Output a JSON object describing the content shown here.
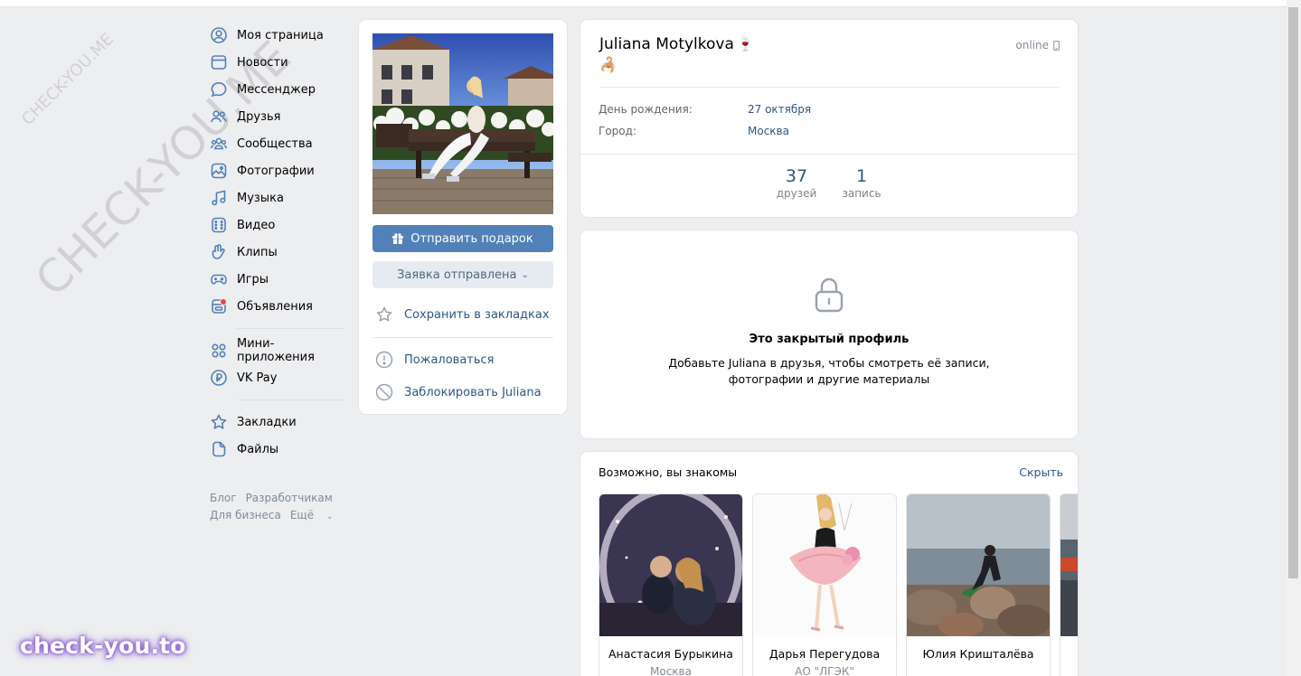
{
  "watermark": {
    "small": "CHECK-YOU.ME",
    "large": "CHECK-YOU.ME"
  },
  "brand": "check-you.to",
  "nav": {
    "items": [
      {
        "label": "Моя страница",
        "icon": "user-circle-icon"
      },
      {
        "label": "Новости",
        "icon": "news-icon"
      },
      {
        "label": "Мессенджер",
        "icon": "message-icon"
      },
      {
        "label": "Друзья",
        "icon": "friends-icon"
      },
      {
        "label": "Сообщества",
        "icon": "communities-icon"
      },
      {
        "label": "Фотографии",
        "icon": "photos-icon"
      },
      {
        "label": "Музыка",
        "icon": "music-icon"
      },
      {
        "label": "Видео",
        "icon": "video-icon"
      },
      {
        "label": "Клипы",
        "icon": "clips-icon"
      },
      {
        "label": "Игры",
        "icon": "gamepad-icon"
      },
      {
        "label": "Объявления",
        "icon": "ads-icon"
      }
    ],
    "items2": [
      {
        "label": "Мини-приложения",
        "icon": "apps-icon"
      },
      {
        "label": "VK Pay",
        "icon": "vkpay-icon"
      }
    ],
    "items3": [
      {
        "label": "Закладки",
        "icon": "star-icon"
      },
      {
        "label": "Файлы",
        "icon": "file-icon"
      }
    ],
    "footer": {
      "blog": "Блог",
      "dev": "Разработчикам",
      "business": "Для бизнеса",
      "more": "Ещё"
    }
  },
  "actions": {
    "send_gift": "Отправить подарок",
    "request_sent": "Заявка отправлена",
    "bookmark": "Сохранить в закладках",
    "report": "Пожаловаться",
    "block": "Заблокировать Juliana"
  },
  "profile": {
    "name": "Juliana Motylkova",
    "status": "online",
    "birthday_label": "День рождения:",
    "birthday_value": "27 октября",
    "city_label": "Город:",
    "city_value": "Москва",
    "counters": [
      {
        "num": "37",
        "label": "друзей"
      },
      {
        "num": "1",
        "label": "запись"
      }
    ]
  },
  "closed": {
    "title": "Это закрытый профиль",
    "line1": "Добавьте Juliana в друзья, чтобы смотреть её записи,",
    "line2": "фотографии и другие материалы"
  },
  "suggestions": {
    "title": "Возможно, вы знакомы",
    "hide": "Скрыть",
    "people": [
      {
        "name": "Анастасия Бурыкина",
        "sub": "Москва"
      },
      {
        "name": "Дарья Перегудова",
        "sub": "АО \"ЛГЭК\""
      },
      {
        "name": "Юлия Кришталёва",
        "sub": ""
      }
    ]
  },
  "colors": {
    "accent": "#5181b8",
    "link": "#2a5885",
    "bg": "#edeef0"
  }
}
